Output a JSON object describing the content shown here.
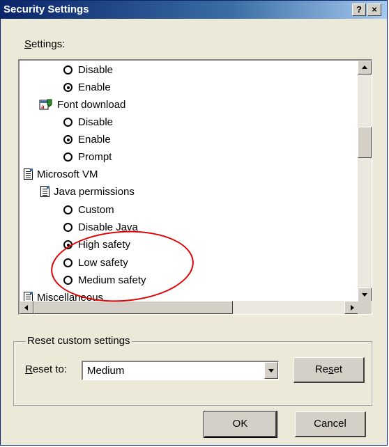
{
  "window": {
    "title": "Security Settings",
    "help_button": "?",
    "close_button": "×"
  },
  "settings_label": {
    "accel": "S",
    "rest": "ettings:"
  },
  "tree": {
    "items": [
      {
        "label": "Disable",
        "kind": "radio",
        "selected": false
      },
      {
        "label": "Enable",
        "kind": "radio",
        "selected": true
      },
      {
        "label": "Font download",
        "kind": "category",
        "icon": "font-download-icon"
      },
      {
        "label": "Disable",
        "kind": "radio",
        "selected": false
      },
      {
        "label": "Enable",
        "kind": "radio",
        "selected": true
      },
      {
        "label": "Prompt",
        "kind": "radio",
        "selected": false
      },
      {
        "label": "Microsoft VM",
        "kind": "category",
        "icon": "document-icon"
      },
      {
        "label": "Java permissions",
        "kind": "category",
        "icon": "document-icon"
      },
      {
        "label": "Custom",
        "kind": "radio",
        "selected": false
      },
      {
        "label": "Disable Java",
        "kind": "radio",
        "selected": false
      },
      {
        "label": "High safety",
        "kind": "radio",
        "selected": true
      },
      {
        "label": "Low safety",
        "kind": "radio",
        "selected": false
      },
      {
        "label": "Medium safety",
        "kind": "radio",
        "selected": false
      },
      {
        "label": "Miscellaneous",
        "kind": "category",
        "icon": "gear-document-icon"
      }
    ]
  },
  "reset_group": {
    "legend": "Reset custom settings",
    "reset_to_label": {
      "accel": "R",
      "rest": "eset to:"
    },
    "selected_level": "Medium",
    "reset_button": {
      "pre": "Re",
      "accel": "s",
      "post": "et"
    }
  },
  "footer": {
    "ok_label": "OK",
    "cancel_label": "Cancel"
  },
  "colors": {
    "title_bar": "#0a246a",
    "dialog_bg": "#ece9d8",
    "highlight_ellipse": "#e00000"
  }
}
